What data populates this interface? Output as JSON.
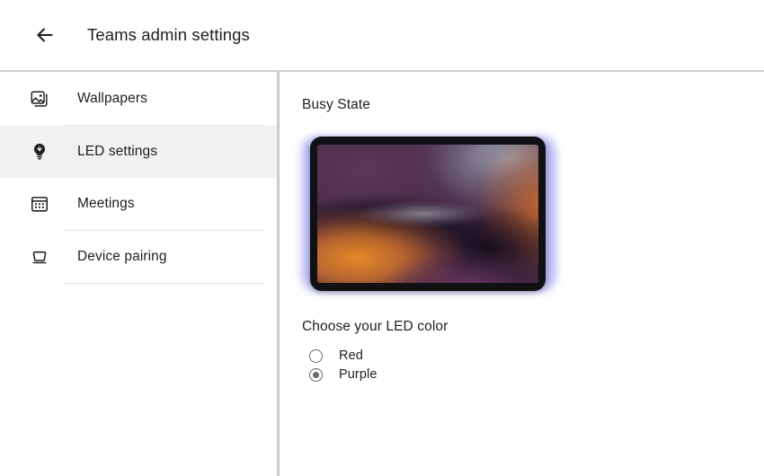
{
  "header": {
    "title": "Teams admin settings",
    "back_icon": "arrow-left-icon"
  },
  "sidebar": {
    "items": [
      {
        "id": "wallpapers",
        "label": "Wallpapers",
        "icon": "image-icon",
        "active": false
      },
      {
        "id": "led-settings",
        "label": "LED settings",
        "icon": "lightbulb-icon",
        "active": true
      },
      {
        "id": "meetings",
        "label": "Meetings",
        "icon": "calendar-icon",
        "active": false
      },
      {
        "id": "device-pairing",
        "label": "Device pairing",
        "icon": "monitor-icon",
        "active": false
      }
    ]
  },
  "main": {
    "section_title": "Busy State",
    "preview": {
      "device_name": "tablet-preview",
      "glow_color": "#aeb0f2",
      "bezel_color": "#111114"
    },
    "chooser": {
      "title": "Choose your LED color",
      "options": [
        {
          "id": "red",
          "label": "Red",
          "selected": false
        },
        {
          "id": "purple",
          "label": "Purple",
          "selected": true
        }
      ]
    }
  },
  "colors": {
    "accent": "#6b6b6b",
    "divider": "#cbcbcb",
    "active_row": "#f1f1f1",
    "text": "#202124"
  }
}
